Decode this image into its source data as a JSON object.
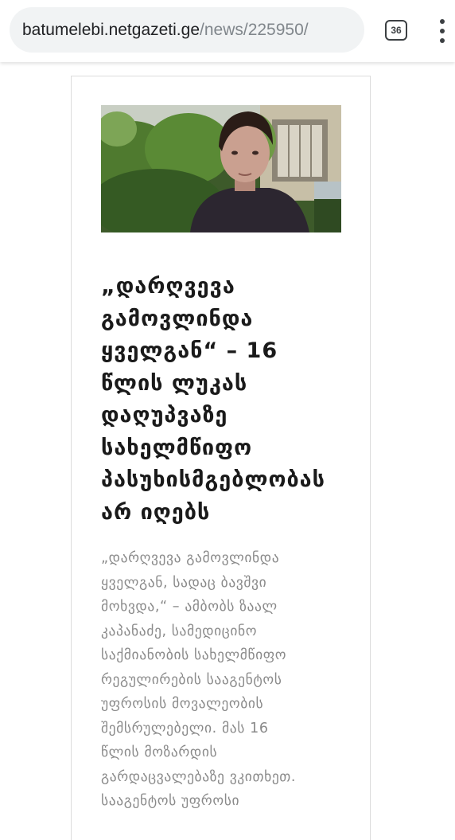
{
  "browser": {
    "url_domain": "batumelebi.netgazeti.ge",
    "url_path": "/news/225950/",
    "tab_count": "36",
    "menu_icon": "more-vert-icon",
    "tab_icon": "tab-switcher-icon"
  },
  "article": {
    "image_alt": "portrait photo of a teenage boy in a dark t-shirt outdoors",
    "headline": "„დარღვევა\nგამოვლინდა\nყველგან“ – 16\nწლის ლუკას\nდაღუპვაზე\nსახელმწიფო\nპასუხისმგებლობას\nარ იღებს",
    "lead": "„დარღვევა გამოვლინდა\nყველგან, სადაც ბავშვი\nმოხვდა,“ – ამბობს ზაალ\nკაპანაძე, სამედიცინო\nსაქმიანობის სახელმწიფო\nრეგულირების სააგენტოს\nუფროსის მოვალეობის\nშემსრულებელი. მას 16\nწლის მოზარდის\nგარდაცვალებაზე ვკითხეთ.\nსააგენტოს უფროსი"
  },
  "colors": {
    "url_bar_bg": "#f1f3f4",
    "headline": "#1a1a1a",
    "lead": "#8a8a8a",
    "card_border": "#dcdcdc"
  }
}
